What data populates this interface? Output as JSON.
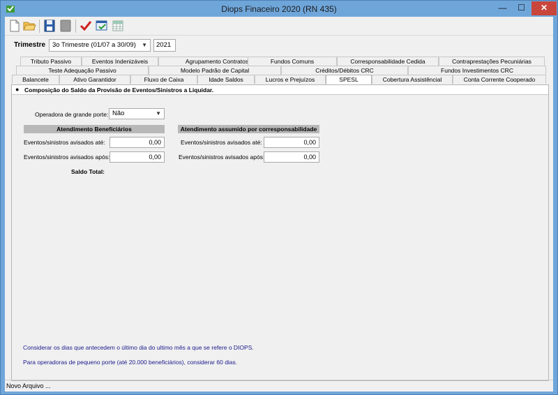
{
  "window": {
    "title": "Diops Finaceiro 2020 (RN 435)"
  },
  "titlebar": {
    "minimize": "—",
    "maximize": "☐",
    "close": "✕"
  },
  "filters": {
    "trimestre_label": "Trimestre",
    "trimestre_value": "3o Trimestre (01/07 a 30/09)",
    "year_value": "2021"
  },
  "tabs": {
    "row1": [
      "Tributo Passivo",
      "Eventos Indenizáveis",
      "Agrupamento Contratos",
      "Fundos Comuns",
      "Corresponsabilidade Cedida",
      "Contraprestações Pecuniárias"
    ],
    "row2": [
      "Teste Adequação Passivo",
      "Modelo Padrão de Capital",
      "Créditos/Débitos CRC",
      "Fundos Investimentos CRC"
    ],
    "row3": [
      "Balancete",
      "Ativo Garantidor",
      "Fluxo de Caixa",
      "Idade Saldos",
      "Lucros e Prejuízos",
      "SPESL",
      "Cobertura Assistêncial",
      "Conta Corrente Cooperado"
    ],
    "active": "SPESL"
  },
  "panel": {
    "heading": "Composição do Saldo da Provisão de Eventos/Sinistros a Liquidar.",
    "operadora_label": "Operadora de grande porte:",
    "operadora_value": "Não",
    "beneficiarios": {
      "heading": "Atendimento Beneficiários",
      "ate_label": "Eventos/sinistros avisados até:",
      "ate_value": "0,00",
      "apos_label": "Eventos/sinistros avisados após:",
      "apos_value": "0,00"
    },
    "corresp": {
      "heading": "Atendimento assumido por corresponsabilidade",
      "ate_label": "Eventos/sinistros avisados até:",
      "ate_value": "0,00",
      "apos_label": "Eventos/sinistros avisados após:",
      "apos_value": "0,00"
    },
    "saldo_total_label": "Saldo Total:",
    "note1": "Considerar os dias que antecedem o último dia do ultimo mês a que se refere o DIOPS.",
    "note2": "Para operadoras de pequeno porte (até 20.000 beneficiários), considerar 60 dias."
  },
  "status": {
    "text": "Novo Arquivo ..."
  },
  "colors": {
    "accent_blue": "#1a1a8c",
    "titlebar": "#6fa6da",
    "close": "#c9463d"
  },
  "toolbar_icons": [
    "new-file-icon",
    "open-folder-icon",
    "save-icon",
    "disabled-icon",
    "check-icon",
    "validate-window-icon",
    "grid-icon"
  ]
}
